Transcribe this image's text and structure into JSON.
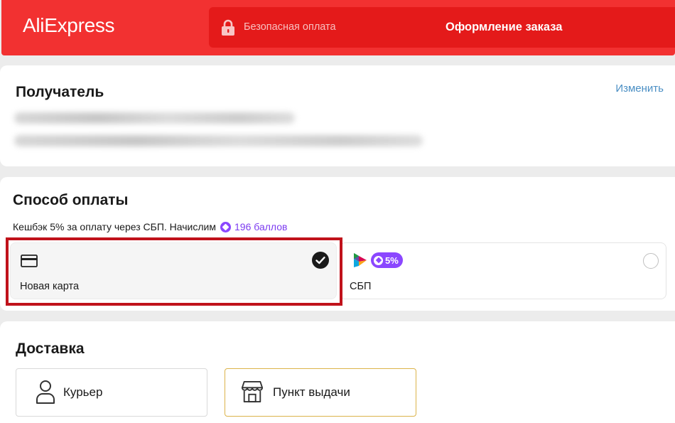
{
  "header": {
    "logo": "AliExpress",
    "secure_label": "Безопасная оплата",
    "title": "Оформление заказа",
    "icons": {
      "lock": "lock-icon"
    },
    "colors": {
      "header_bg": "#f23131",
      "bar_bg": "#e41a1a"
    }
  },
  "recipient": {
    "title": "Получатель",
    "change_link": "Изменить"
  },
  "payment": {
    "title": "Способ оплаты",
    "cashback_text": "Кешбэк 5% за оплату через СБП. Начислим",
    "points_text": "196 баллов",
    "options": [
      {
        "label": "Новая карта",
        "icon": "credit-card-icon",
        "selected": true
      },
      {
        "label": "СБП",
        "icon": "sbp-logo-icon",
        "badge": "5%",
        "selected": false
      }
    ],
    "colors": {
      "accent_purple": "#8b47ff",
      "highlight": "#c0121b"
    }
  },
  "delivery": {
    "title": "Доставка",
    "options": [
      {
        "label": "Курьер",
        "icon": "person-icon",
        "selected": false
      },
      {
        "label": "Пункт выдачи",
        "icon": "store-icon",
        "selected": true
      }
    ],
    "colors": {
      "selected_border": "#dcb34a"
    }
  }
}
